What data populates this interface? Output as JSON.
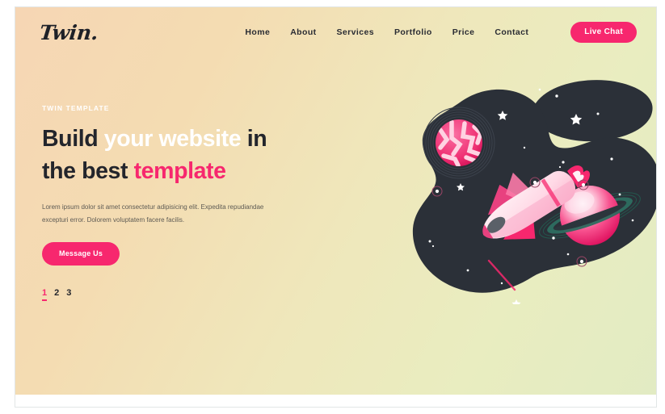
{
  "brand": {
    "logo": "Twin."
  },
  "nav": {
    "links": [
      {
        "label": "Home"
      },
      {
        "label": "About"
      },
      {
        "label": "Services"
      },
      {
        "label": "Portfolio"
      },
      {
        "label": "Price"
      },
      {
        "label": "Contact"
      }
    ],
    "cta": {
      "label": "Live Chat"
    }
  },
  "hero": {
    "eyebrow": "TWIN TEMPLATE",
    "headline": {
      "line1_part1": "Build ",
      "line1_part2": "your website",
      "line1_part3": " in",
      "line2_part1": "the best ",
      "line2_part2": "template"
    },
    "lede": "Lorem ipsum dolor sit amet consectetur adipisicing elit. Expedita repudiandae excepturi error. Dolorem voluptatem facere facilis.",
    "cta": {
      "label": "Message Us"
    },
    "pagination": [
      {
        "label": "1",
        "active": true
      },
      {
        "label": "2",
        "active": false
      },
      {
        "label": "3",
        "active": false
      }
    ]
  },
  "illustration": {
    "name": "space-scene",
    "elements": [
      "dark-nebula-blob",
      "marbled-planet",
      "ringed-planet",
      "space-shuttle",
      "stars",
      "shooting-star"
    ]
  },
  "colors": {
    "accent_pink": "#f7276e",
    "headline_dark": "#23252c",
    "headline_white": "#ffffff",
    "nebula_dark": "#2b3038",
    "bg_start": "#f6d6b4",
    "bg_end": "#e2ebc3",
    "ring_teal": "#2d6a5e"
  }
}
